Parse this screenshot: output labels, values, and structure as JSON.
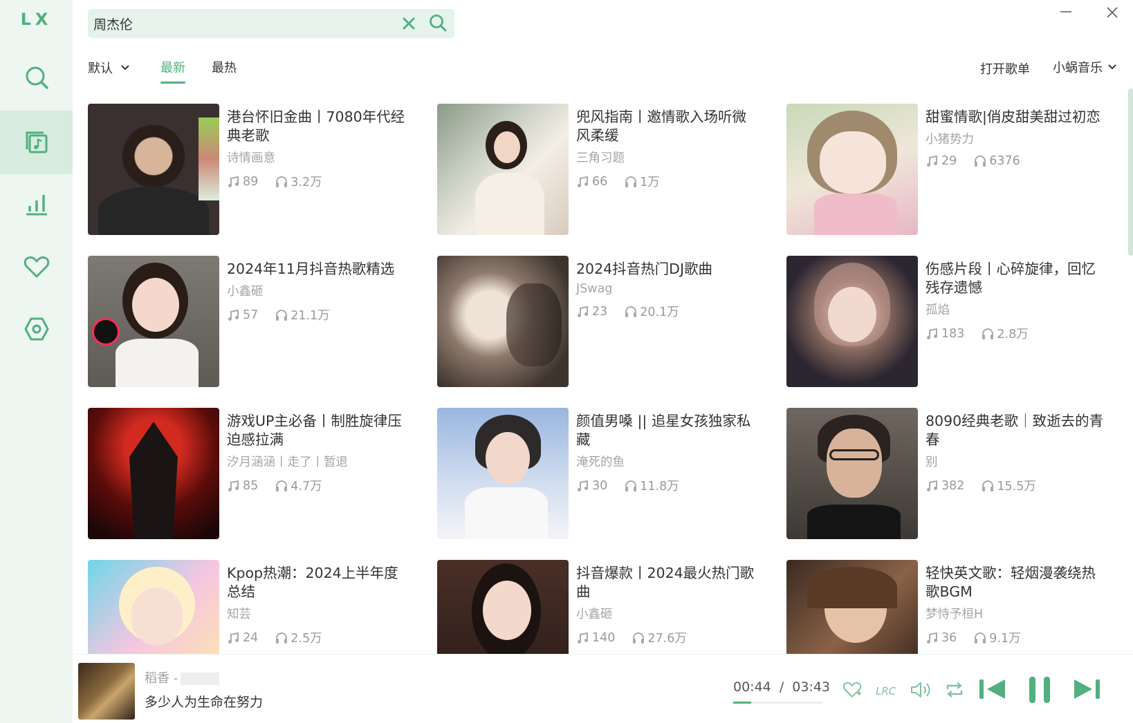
{
  "app": {
    "logo": "LX"
  },
  "sidebar": {
    "items": [
      {
        "name": "search"
      },
      {
        "name": "songlist",
        "active": true
      },
      {
        "name": "leaderboard"
      },
      {
        "name": "favorites"
      },
      {
        "name": "settings"
      }
    ]
  },
  "search": {
    "value": "周杰伦",
    "placeholder": ""
  },
  "toolbar": {
    "sort_label": "默认",
    "tabs": [
      {
        "label": "最新",
        "active": true
      },
      {
        "label": "最热",
        "active": false
      }
    ],
    "open_list_label": "打开歌单",
    "source_label": "小蜗音乐"
  },
  "playlists": [
    {
      "title": "港台怀旧金曲丨7080年代经典老歌",
      "author": "诗情画意",
      "songs": "89",
      "plays": "3.2万"
    },
    {
      "title": "兜风指南丨邀情歌入场听微风柔缓",
      "author": "三角习题",
      "songs": "66",
      "plays": "1万"
    },
    {
      "title": "甜蜜情歌|俏皮甜美甜过初恋",
      "author": "小猪势力",
      "songs": "29",
      "plays": "6376"
    },
    {
      "title": "2024年11月抖音热歌精选",
      "author": "小鑫砸",
      "songs": "57",
      "plays": "21.1万"
    },
    {
      "title": "2024抖音热门DJ歌曲",
      "author": "JSwag",
      "songs": "23",
      "plays": "20.1万"
    },
    {
      "title": "伤感片段丨心碎旋律，回忆残存遗憾",
      "author": "孤焰",
      "songs": "183",
      "plays": "2.8万"
    },
    {
      "title": "游戏UP主必备丨制胜旋律压迫感拉满",
      "author": "汐月涵涵丨走了丨暂退",
      "songs": "85",
      "plays": "4.7万"
    },
    {
      "title": "颜值男嗓 || 追星女孩独家私藏",
      "author": "淹死的鱼",
      "songs": "30",
      "plays": "11.8万"
    },
    {
      "title": "8090经典老歌｜致逝去的青春",
      "author": "别",
      "songs": "382",
      "plays": "15.5万"
    },
    {
      "title": "Kpop热潮：2024上半年度总结",
      "author": "知芸",
      "songs": "24",
      "plays": "2.5万"
    },
    {
      "title": "抖音爆款丨2024最火热门歌曲",
      "author": "小鑫砸",
      "songs": "140",
      "plays": "27.6万"
    },
    {
      "title": "轻快英文歌：轻烟漫袭绕热歌BGM",
      "author": "梦恃予桓H",
      "songs": "36",
      "plays": "9.1万"
    }
  ],
  "player": {
    "song": "稻香 -",
    "lyric": "多少人为生命在努力",
    "current_time": "00:44",
    "separator": "/",
    "duration": "03:43",
    "progress": 0.197
  },
  "colors": {
    "accent": "#51b07d",
    "sidebar_bg": "#eef6f1",
    "sidebar_active": "#d7ecdf"
  }
}
